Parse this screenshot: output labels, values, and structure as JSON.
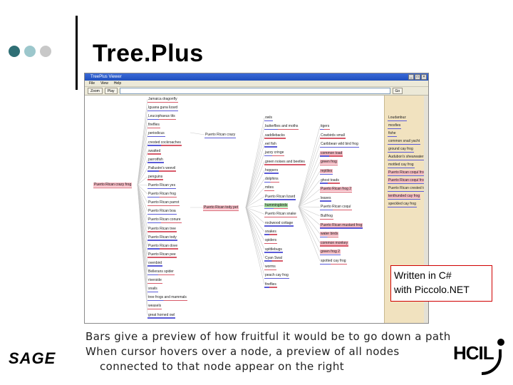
{
  "slide": {
    "title": "Tree.Plus",
    "callout": [
      "Written in C#",
      "with Piccolo.NET"
    ],
    "caption": [
      "Bars give a preview of how fruitful it would be to go down a path",
      "When cursor hovers over a node, a preview of all nodes",
      "connected to that node appear on the right"
    ],
    "left_logo": "SAGE",
    "right_logo": "HCIL"
  },
  "window": {
    "title": "TreePlus Viewer",
    "menu": [
      "File",
      "View",
      "Help"
    ],
    "toolbar": {
      "zoom_label": "Zoom",
      "play_label": "Play",
      "go_label": "Go"
    }
  },
  "tree": {
    "root": "Puerto Rican crazy frog",
    "col1": [
      "Jamaica dragonfly",
      "Iguana guna lizard",
      "Leucophaeus tits",
      "fireflies",
      "periodicus",
      "crested cockroaches",
      "swatted",
      "parrotfish",
      "Pallustre's weevil",
      "penguins",
      "Puerto Rican yes",
      "Puerto Rican frog",
      "Puerto Rican parrot",
      "Puerto Rican boa",
      "Puerto Rican conure",
      "Puerto Rican tree",
      "Puerto Rican tody",
      "Puerto Rican dove",
      "Puerto Rican pee",
      "ovenbird",
      "Bellerans spider",
      "riverside",
      "snails",
      "tree frogs and mammals",
      "weasels",
      "great horned owl"
    ],
    "hub1": "Puerto Rican crazy",
    "hub2": "Puerto Rican tody pet",
    "col2": [
      "owls",
      "butterflies and moths",
      "saddlebacks",
      "eel fish",
      "jazzy cringe",
      "green noises and beetles",
      "hoppers",
      "dolphins",
      "mites",
      "Puerto Rican lizard",
      "hummingbirds",
      "Puerto Rican snake",
      "rockwood cottage",
      "snakes",
      "spiders",
      "spittlebugs",
      "Cyan Swal",
      "worms",
      "peach cay frog",
      "fireflies"
    ],
    "col3": [
      "tigers",
      "Cowbirds small",
      "Caribbean wild bird frog",
      "common toad",
      "green frog",
      "reptiles",
      "ghost toads",
      "Puerto Rican frog 2",
      "leaves",
      "Puerto Rican coquí",
      "Bullfrog",
      "Puerto Rican mustard frog",
      "water birds",
      "common monkey",
      "green frog 2",
      "spotted cay frog"
    ],
    "pink3": [
      3,
      4,
      5,
      7,
      11,
      12,
      13,
      14
    ],
    "preview": [
      "Loudanbuz",
      "mosfies",
      "fishe",
      "common snail yacht",
      "ground cay frog",
      "Audubon's shearwater",
      "mottled cay frog",
      "Puerto Rican coquí frog 1",
      "Puerto Rican coquí frog 2",
      "Puerto Rican crested toad",
      "tenthunded cay frog",
      "speckled cay frog"
    ],
    "pink_preview": [
      7,
      8,
      10
    ]
  }
}
